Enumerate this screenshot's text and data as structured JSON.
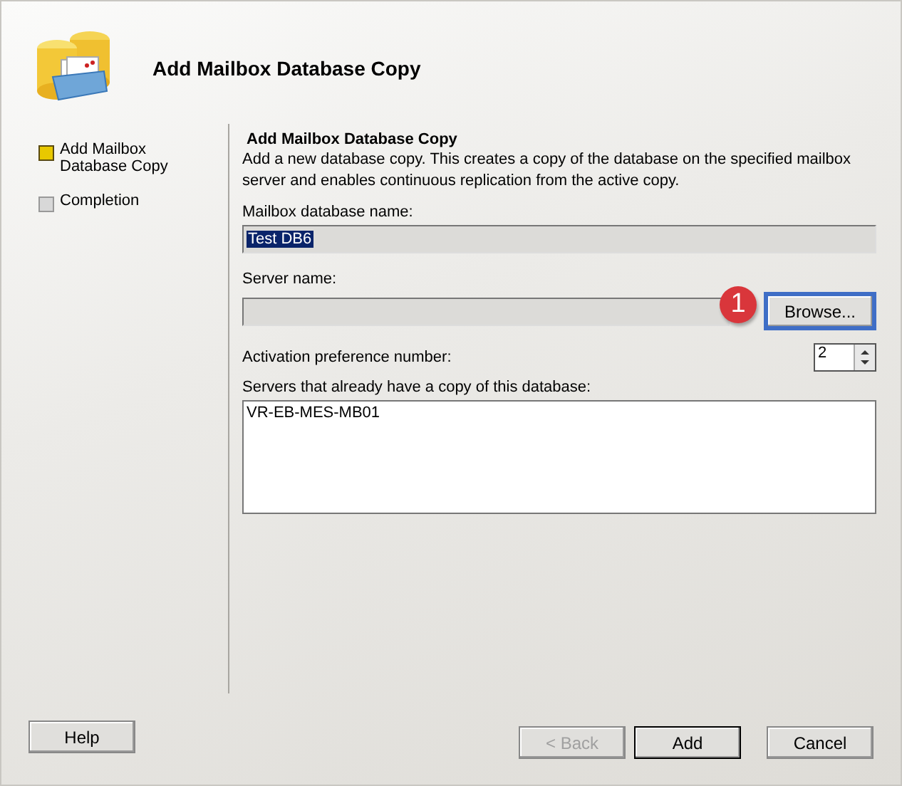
{
  "header": {
    "title": "Add Mailbox Database Copy"
  },
  "steps": [
    {
      "label": "Add Mailbox Database Copy",
      "selected": true
    },
    {
      "label": "Completion",
      "selected": false
    }
  ],
  "page": {
    "heading": "Add Mailbox Database Copy",
    "description": "Add a new database copy. This creates a copy of the database on the specified mailbox server and enables continuous replication from the active copy.",
    "database_name": {
      "label": "Mailbox database name:",
      "value": "Test DB6",
      "selected": true
    },
    "server_name": {
      "label": "Server name:",
      "browse": {
        "label": "Browse...",
        "highlighted": true
      },
      "callout": "1"
    },
    "activation_preference": {
      "label": "Activation preference number:",
      "value": "2"
    },
    "servers": {
      "label": "Servers that already have a copy of this database:",
      "items": [
        "VR-EB-MES-MB01"
      ]
    }
  },
  "buttons": [
    {
      "label": "Help",
      "kind": "help",
      "disabled": false,
      "default": false
    },
    {
      "label": "< Back",
      "kind": "nav",
      "disabled": true,
      "default": false
    },
    {
      "label": "Add",
      "kind": "nav",
      "disabled": false,
      "default": true
    },
    {
      "label": "Cancel",
      "kind": "nav",
      "disabled": false,
      "default": false
    }
  ]
}
